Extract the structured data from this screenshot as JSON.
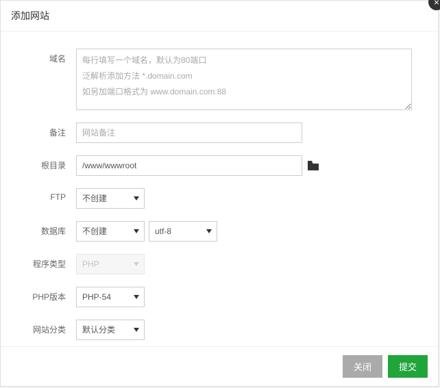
{
  "dialog": {
    "title": "添加网站",
    "close_x": "×"
  },
  "labels": {
    "domain": "域名",
    "note": "备注",
    "root": "根目录",
    "ftp": "FTP",
    "database": "数据库",
    "program_type": "程序类型",
    "php_version": "PHP版本",
    "site_category": "网站分类"
  },
  "fields": {
    "domain_placeholder": "每行填写一个域名，默认为80端口\n泛解析添加方法 *.domain.com\n如另加端口格式为 www.domain.com:88",
    "note_placeholder": "网站备注",
    "root_value": "/www/wwwroot",
    "ftp_selected": "不创建",
    "db_selected": "不创建",
    "charset_selected": "utf-8",
    "program_type_selected": "PHP",
    "php_version_selected": "PHP-54",
    "category_selected": "默认分类"
  },
  "footer": {
    "close_label": "关闭",
    "submit_label": "提交"
  }
}
